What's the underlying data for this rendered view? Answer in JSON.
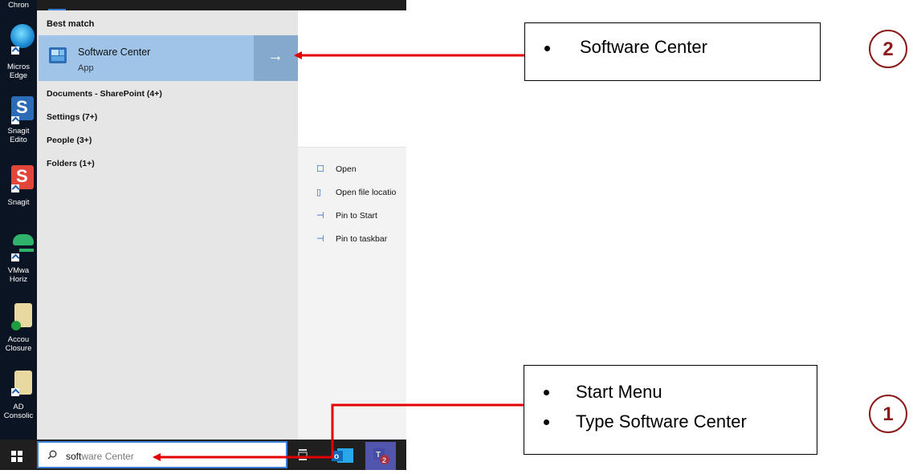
{
  "desktop": {
    "icons": [
      {
        "name": "chrome",
        "label": "Chron",
        "color": "#3a6"
      },
      {
        "name": "edge",
        "label": "Micros\nEdge",
        "color": "#1a8ad4"
      },
      {
        "name": "snagit-editor",
        "label": "Snagit\nEdito",
        "color": "#2c6bb5"
      },
      {
        "name": "snagit",
        "label": "Snagit",
        "color": "#e2463a"
      },
      {
        "name": "vmware-horizon",
        "label": "VMwa\nHoriz",
        "color": "#3c9"
      },
      {
        "name": "account-closures",
        "label": "Accou\nClosure",
        "color": "#d9c47a"
      },
      {
        "name": "ad-consolidation",
        "label": "AD\nConsolic",
        "color": "#d9c47a"
      }
    ]
  },
  "start_menu": {
    "best_match_heading": "Best match",
    "best_match": {
      "title": "Software Center",
      "subtitle": "App",
      "arrow": "→"
    },
    "categories": [
      "Documents - SharePoint (4+)",
      "Settings (7+)",
      "People (3+)",
      "Folders (1+)"
    ]
  },
  "preview": {
    "actions": [
      {
        "icon": "open-icon",
        "glyph": "☐",
        "label": "Open"
      },
      {
        "icon": "folder-icon",
        "glyph": "▯",
        "label": "Open file locatio"
      },
      {
        "icon": "pin-icon",
        "glyph": "⊣",
        "label": "Pin to Start"
      },
      {
        "icon": "pin-icon",
        "glyph": "⊣",
        "label": "Pin to taskbar"
      }
    ]
  },
  "taskbar": {
    "search_typed": "soft",
    "search_rest": "ware Center"
  },
  "callouts": {
    "top": {
      "items": [
        "Software Center"
      ],
      "number": "2"
    },
    "bottom": {
      "items": [
        "Start Menu",
        "Type Software Center"
      ],
      "number": "1"
    }
  },
  "colors": {
    "arrow": "#e30000",
    "circle": "#8b1a1a",
    "tile": "#9fc4e8"
  }
}
